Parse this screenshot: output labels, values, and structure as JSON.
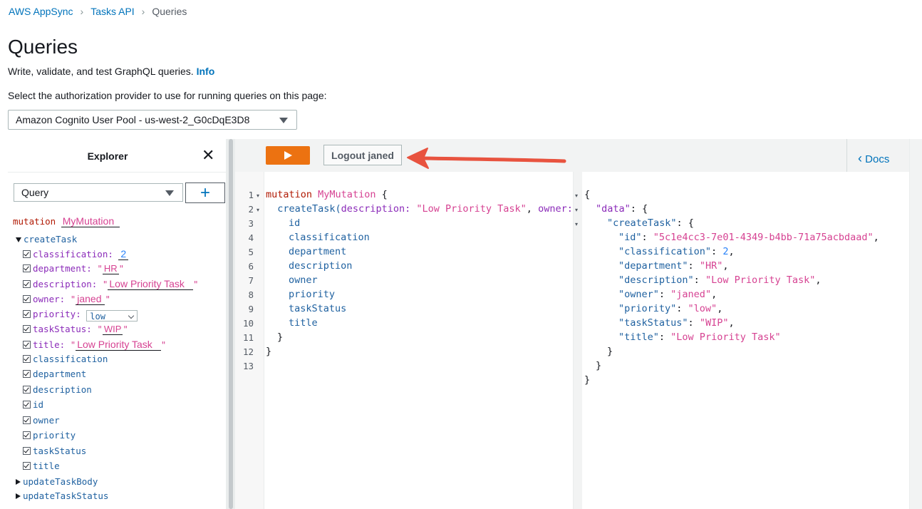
{
  "breadcrumb": [
    {
      "label": "AWS AppSync",
      "link": true
    },
    {
      "label": "Tasks API",
      "link": true
    },
    {
      "label": "Queries",
      "link": false
    }
  ],
  "page": {
    "title": "Queries",
    "subtitle": "Write, validate, and test GraphQL queries.",
    "info_link": "Info",
    "auth_label": "Select the authorization provider to use for running queries on this page:",
    "auth_value": "Amazon Cognito User Pool - us-west-2_G0cDqE3D8"
  },
  "explorer": {
    "title": "Explorer",
    "operation_type": "Query",
    "add_label": "+",
    "mutation_keyword": "mutation",
    "mutation_name": "MyMutation",
    "root_field": "createTask",
    "args": [
      {
        "name": "classification:",
        "value": "2",
        "kind": "number"
      },
      {
        "name": "department:",
        "value": "HR",
        "kind": "string"
      },
      {
        "name": "description:",
        "value": "Low Priority Task",
        "kind": "string"
      },
      {
        "name": "owner:",
        "value": "janed",
        "kind": "string"
      },
      {
        "name": "priority:",
        "value": "low",
        "kind": "select"
      },
      {
        "name": "taskStatus:",
        "value": "WIP",
        "kind": "string"
      },
      {
        "name": "title:",
        "value": "Low Priority Task",
        "kind": "string"
      }
    ],
    "fields": [
      "classification",
      "department",
      "description",
      "id",
      "owner",
      "priority",
      "taskStatus",
      "title"
    ],
    "collapsed": [
      "updateTaskBody",
      "updateTaskStatus"
    ]
  },
  "toolbar": {
    "run_icon": "play-icon",
    "logout_label": "Logout janed",
    "docs_label": "Docs"
  },
  "editor": {
    "line_numbers": [
      "1",
      "2",
      "3",
      "4",
      "5",
      "6",
      "7",
      "8",
      "9",
      "10",
      "11",
      "12",
      "13"
    ],
    "line1_kw": "mutation",
    "line1_name": "MyMutation",
    "line1_brace": " {",
    "line2_field": "createTask(",
    "line2_arg1": "description:",
    "line2_val1": "\"Low Priority Task\"",
    "line2_comma": ",",
    "line2_arg2": "owner:",
    "line2_val2": "\"",
    "fields": [
      "id",
      "classification",
      "department",
      "description",
      "owner",
      "priority",
      "taskStatus",
      "title"
    ],
    "close_inner": "}",
    "close_outer": "}"
  },
  "result": {
    "open": "{",
    "data_key": "\"data\"",
    "create_key": "\"createTask\"",
    "entries": [
      {
        "key": "\"id\"",
        "value": "\"5c1e4cc3-7e01-4349-b4bb-71a75acbdaad\"",
        "kind": "string",
        "trail": ","
      },
      {
        "key": "\"classification\"",
        "value": "2",
        "kind": "number",
        "trail": ","
      },
      {
        "key": "\"department\"",
        "value": "\"HR\"",
        "kind": "string",
        "trail": ","
      },
      {
        "key": "\"description\"",
        "value": "\"Low Priority Task\"",
        "kind": "string",
        "trail": ","
      },
      {
        "key": "\"owner\"",
        "value": "\"janed\"",
        "kind": "string",
        "trail": ","
      },
      {
        "key": "\"priority\"",
        "value": "\"low\"",
        "kind": "string",
        "trail": ","
      },
      {
        "key": "\"taskStatus\"",
        "value": "\"WIP\"",
        "kind": "string",
        "trail": ","
      },
      {
        "key": "\"title\"",
        "value": "\"Low Priority Task\"",
        "kind": "string",
        "trail": ""
      }
    ],
    "close": "}"
  },
  "colors": {
    "run_button": "#ec7211",
    "arrow": "#e8533f",
    "link": "#0073bb"
  }
}
